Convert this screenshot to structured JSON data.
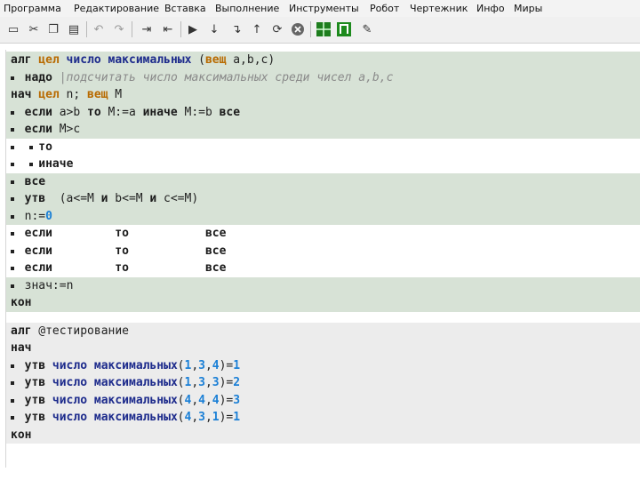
{
  "menu": [
    "Программа",
    "Редактирование",
    "Вставка",
    "Выполнение",
    "Инструменты",
    "Робот",
    "Чертежник",
    "Инфо",
    "Миры"
  ],
  "toolbar": {
    "icons": [
      "new-file-icon",
      "cut-icon",
      "copy-icon",
      "paste-icon",
      "undo-icon",
      "redo-icon",
      "indent-icon",
      "unindent-icon",
      "run-icon",
      "step-icon",
      "step-in-icon",
      "step-out-icon",
      "debug-icon",
      "stop-icon",
      "robot-icon",
      "draftsman-icon",
      "edit-icon"
    ]
  },
  "code": {
    "main": [
      {
        "bg": "green",
        "tokens": [
          {
            "c": 0,
            "t": "алг",
            "s": "kw"
          },
          {
            "c": 4,
            "t": "цел",
            "s": "ty"
          },
          {
            "c": 8,
            "t": "число максимальных",
            "s": "fn"
          },
          {
            "c": 27,
            "t": "(",
            "s": "pl"
          },
          {
            "c": 28,
            "t": "вещ",
            "s": "ty"
          },
          {
            "c": 32,
            "t": "a,b,c)",
            "s": "pl"
          }
        ]
      },
      {
        "bg": "green",
        "dots": 1,
        "tokens": [
          {
            "c": 2,
            "t": "надо",
            "s": "kw"
          },
          {
            "c": 7,
            "t": "|подсчитать число максимальных среди чисел a,b,c",
            "s": "cm"
          }
        ]
      },
      {
        "bg": "green",
        "tokens": [
          {
            "c": 0,
            "t": "нач",
            "s": "kw"
          },
          {
            "c": 4,
            "t": "цел",
            "s": "ty"
          },
          {
            "c": 8,
            "t": "n;",
            "s": "pl"
          },
          {
            "c": 11,
            "t": "вещ",
            "s": "ty"
          },
          {
            "c": 15,
            "t": "M",
            "s": "pl"
          }
        ]
      },
      {
        "bg": "green",
        "dots": 1,
        "tokens": [
          {
            "c": 2,
            "t": "если",
            "s": "kw"
          },
          {
            "c": 7,
            "t": "a>b",
            "s": "pl"
          },
          {
            "c": 11,
            "t": "то",
            "s": "kw"
          },
          {
            "c": 14,
            "t": "M:=a",
            "s": "pl"
          },
          {
            "c": 19,
            "t": "иначе",
            "s": "kw"
          },
          {
            "c": 25,
            "t": "M:=b",
            "s": "pl"
          },
          {
            "c": 30,
            "t": "все",
            "s": "kw"
          }
        ]
      },
      {
        "bg": "green",
        "dots": 1,
        "tokens": [
          {
            "c": 2,
            "t": "если",
            "s": "kw"
          },
          {
            "c": 7,
            "t": "M>c",
            "s": "pl"
          }
        ]
      },
      {
        "bg": "white",
        "dots": 2,
        "tokens": [
          {
            "c": 4,
            "t": "то",
            "s": "kw"
          }
        ]
      },
      {
        "bg": "white",
        "dots": 2,
        "tokens": [
          {
            "c": 4,
            "t": "иначе",
            "s": "kw"
          }
        ]
      },
      {
        "bg": "green",
        "dots": 1,
        "tokens": [
          {
            "c": 2,
            "t": "все",
            "s": "kw"
          }
        ]
      },
      {
        "bg": "green",
        "dots": 1,
        "tokens": [
          {
            "c": 2,
            "t": "утв",
            "s": "kw"
          },
          {
            "c": 7,
            "t": "(a<=M",
            "s": "pl"
          },
          {
            "c": 13,
            "t": "и",
            "s": "kw"
          },
          {
            "c": 15,
            "t": "b<=M",
            "s": "pl"
          },
          {
            "c": 20,
            "t": "и",
            "s": "kw"
          },
          {
            "c": 22,
            "t": "c<=M)",
            "s": "pl"
          }
        ]
      },
      {
        "bg": "green",
        "dots": 1,
        "tokens": [
          {
            "c": 2,
            "t": "n:=",
            "s": "pl"
          },
          {
            "c": 5,
            "t": "0",
            "s": "num"
          }
        ]
      },
      {
        "bg": "white",
        "dots": 1,
        "tokens": [
          {
            "c": 2,
            "t": "если",
            "s": "kw"
          },
          {
            "c": 15,
            "t": "то",
            "s": "kw"
          },
          {
            "c": 28,
            "t": "все",
            "s": "kw"
          }
        ]
      },
      {
        "bg": "white",
        "dots": 1,
        "tokens": [
          {
            "c": 2,
            "t": "если",
            "s": "kw"
          },
          {
            "c": 15,
            "t": "то",
            "s": "kw"
          },
          {
            "c": 28,
            "t": "все",
            "s": "kw"
          }
        ]
      },
      {
        "bg": "white",
        "dots": 1,
        "tokens": [
          {
            "c": 2,
            "t": "если",
            "s": "kw"
          },
          {
            "c": 15,
            "t": "то",
            "s": "kw"
          },
          {
            "c": 28,
            "t": "все",
            "s": "kw"
          }
        ]
      },
      {
        "bg": "green",
        "dots": 1,
        "tokens": [
          {
            "c": 2,
            "t": "знач:=n",
            "s": "pl"
          }
        ]
      },
      {
        "bg": "green",
        "tokens": [
          {
            "c": 0,
            "t": "кон",
            "s": "kw"
          }
        ]
      }
    ],
    "test": [
      {
        "bg": "gray",
        "tokens": [
          {
            "c": 0,
            "t": "алг",
            "s": "kw"
          },
          {
            "c": 4,
            "t": "@тестирование",
            "s": "pl"
          }
        ]
      },
      {
        "bg": "gray",
        "tokens": [
          {
            "c": 0,
            "t": "нач",
            "s": "kw"
          }
        ]
      },
      {
        "bg": "gray",
        "dots": 1,
        "tokens": [
          {
            "c": 2,
            "t": "утв",
            "s": "kw"
          },
          {
            "c": 6,
            "t": "число максимальных",
            "s": "fn"
          },
          {
            "c": 24,
            "t": "(",
            "s": "pl"
          },
          {
            "c": 25,
            "t": "1",
            "s": "num"
          },
          {
            "c": 26,
            "t": ",",
            "s": "pl"
          },
          {
            "c": 27,
            "t": "3",
            "s": "num"
          },
          {
            "c": 28,
            "t": ",",
            "s": "pl"
          },
          {
            "c": 29,
            "t": "4",
            "s": "num"
          },
          {
            "c": 30,
            "t": ")=",
            "s": "pl"
          },
          {
            "c": 32,
            "t": "1",
            "s": "num"
          }
        ]
      },
      {
        "bg": "gray",
        "dots": 1,
        "tokens": [
          {
            "c": 2,
            "t": "утв",
            "s": "kw"
          },
          {
            "c": 6,
            "t": "число максимальных",
            "s": "fn"
          },
          {
            "c": 24,
            "t": "(",
            "s": "pl"
          },
          {
            "c": 25,
            "t": "1",
            "s": "num"
          },
          {
            "c": 26,
            "t": ",",
            "s": "pl"
          },
          {
            "c": 27,
            "t": "3",
            "s": "num"
          },
          {
            "c": 28,
            "t": ",",
            "s": "pl"
          },
          {
            "c": 29,
            "t": "3",
            "s": "num"
          },
          {
            "c": 30,
            "t": ")=",
            "s": "pl"
          },
          {
            "c": 32,
            "t": "2",
            "s": "num"
          }
        ]
      },
      {
        "bg": "gray",
        "dots": 1,
        "tokens": [
          {
            "c": 2,
            "t": "утв",
            "s": "kw"
          },
          {
            "c": 6,
            "t": "число максимальных",
            "s": "fn"
          },
          {
            "c": 24,
            "t": "(",
            "s": "pl"
          },
          {
            "c": 25,
            "t": "4",
            "s": "num"
          },
          {
            "c": 26,
            "t": ",",
            "s": "pl"
          },
          {
            "c": 27,
            "t": "4",
            "s": "num"
          },
          {
            "c": 28,
            "t": ",",
            "s": "pl"
          },
          {
            "c": 29,
            "t": "4",
            "s": "num"
          },
          {
            "c": 30,
            "t": ")=",
            "s": "pl"
          },
          {
            "c": 32,
            "t": "3",
            "s": "num"
          }
        ]
      },
      {
        "bg": "gray",
        "dots": 1,
        "tokens": [
          {
            "c": 2,
            "t": "утв",
            "s": "kw"
          },
          {
            "c": 6,
            "t": "число максимальных",
            "s": "fn"
          },
          {
            "c": 24,
            "t": "(",
            "s": "pl"
          },
          {
            "c": 25,
            "t": "4",
            "s": "num"
          },
          {
            "c": 26,
            "t": ",",
            "s": "pl"
          },
          {
            "c": 27,
            "t": "3",
            "s": "num"
          },
          {
            "c": 28,
            "t": ",",
            "s": "pl"
          },
          {
            "c": 29,
            "t": "1",
            "s": "num"
          },
          {
            "c": 30,
            "t": ")=",
            "s": "pl"
          },
          {
            "c": 32,
            "t": "1",
            "s": "num"
          }
        ]
      },
      {
        "bg": "gray",
        "tokens": [
          {
            "c": 0,
            "t": "кон",
            "s": "kw"
          }
        ]
      }
    ]
  }
}
